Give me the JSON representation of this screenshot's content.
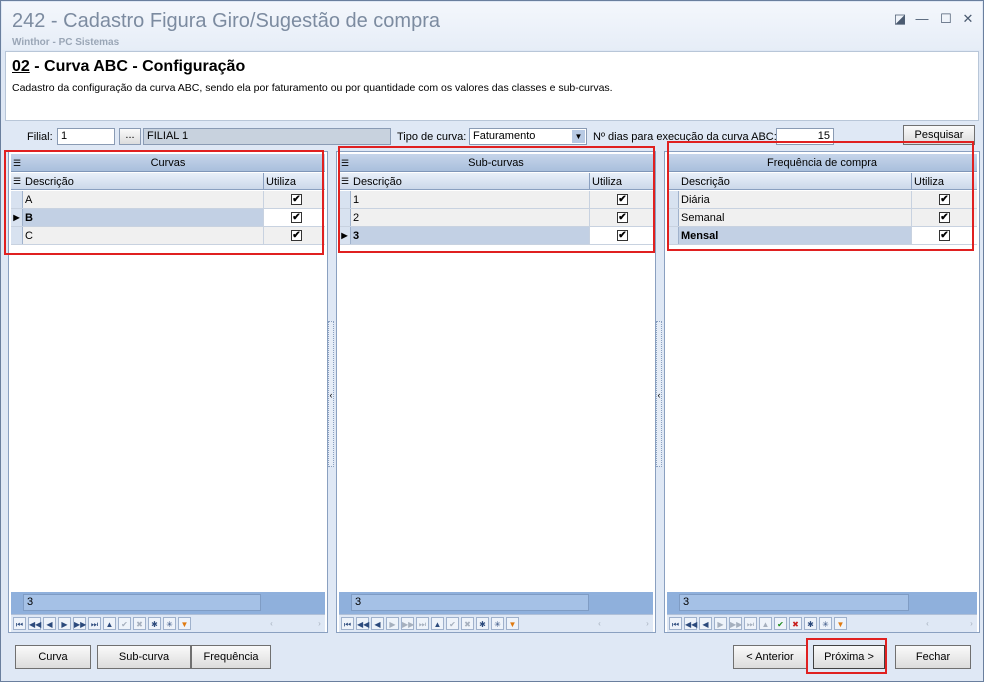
{
  "window": {
    "title": "242 - Cadastro Figura Giro/Sugestão de compra",
    "subtitle": "Winthor - PC Sistemas",
    "controls": {
      "restore": "◪",
      "minimize": "—",
      "maximize": "☐",
      "close": "✕"
    }
  },
  "header": {
    "step": "02",
    "title": " - Curva ABC - Configuração",
    "description": "Cadastro da configuração da curva ABC, sendo ela por faturamento ou por quantidade com os valores das classes e sub-curvas."
  },
  "filters": {
    "filial_label": "Filial:",
    "filial_value": "1",
    "lookup_btn": "...",
    "filial_name": "FILIAL 1",
    "tipo_label": "Tipo de curva:",
    "tipo_value": "Faturamento",
    "dias_label": "Nº dias para execução da curva ABC:",
    "dias_value": "15",
    "pesquisar": "Pesquisar"
  },
  "curvas": {
    "title": "Curvas",
    "col_desc": "Descrição",
    "col_utiliza": "Utiliza",
    "rows": [
      {
        "desc": "A",
        "check": "✔"
      },
      {
        "desc": "B",
        "check": "✔"
      },
      {
        "desc": "C",
        "check": "✔"
      }
    ],
    "footer": "3"
  },
  "subcurvas": {
    "title": "Sub-curvas",
    "col_desc": "Descrição",
    "col_utiliza": "Utiliza",
    "rows": [
      {
        "desc": "1",
        "check": "✔"
      },
      {
        "desc": "2",
        "check": "✔"
      },
      {
        "desc": "3",
        "check": "✔"
      }
    ],
    "footer": "3"
  },
  "frequencia": {
    "title": "Frequência de compra",
    "col_desc": "Descrição",
    "col_utiliza": "Utiliza",
    "rows": [
      {
        "desc": "Diária",
        "check": "✔"
      },
      {
        "desc": "Semanal",
        "check": "✔"
      },
      {
        "desc": "Mensal",
        "check": "✔"
      }
    ],
    "footer": "3"
  },
  "nav_glyphs": {
    "first": "⏮",
    "prevpage": "◀◀",
    "prev": "◀",
    "next": "▶",
    "nextpage": "▶▶",
    "last": "⏭",
    "insert": "▲",
    "post": "✔",
    "cancel": "✖",
    "refresh": "✱",
    "bookmark": "✳",
    "filter": "▼",
    "left": "‹",
    "right": "›"
  },
  "buttons": {
    "curva": "Curva",
    "subcurva": "Sub-curva",
    "frequencia": "Frequência",
    "anterior": "< Anterior",
    "proxima": "Próxima >",
    "fechar": "Fechar"
  },
  "colors": {
    "highlight": "#e02020",
    "grid_header": "#a9bfdc",
    "selected_row": "#c2d0e4"
  }
}
